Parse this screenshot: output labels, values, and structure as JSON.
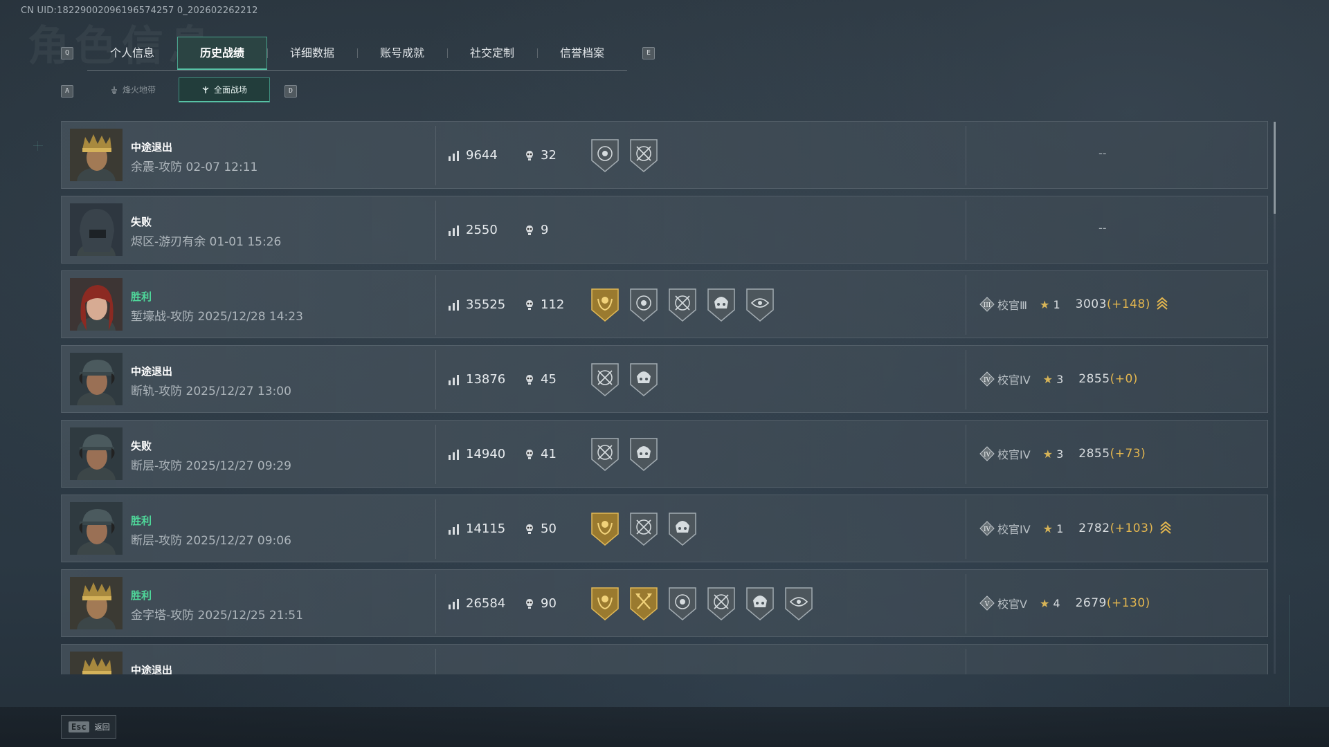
{
  "uid": "CN UID:18229002096196574257 0_202602262212",
  "ghost_title": "角色信息",
  "keys": {
    "prev_tab": "Q",
    "next_tab": "E",
    "prev_sub": "A",
    "next_sub": "D"
  },
  "tabs": [
    {
      "label": "个人信息",
      "active": false
    },
    {
      "label": "历史战绩",
      "active": true
    },
    {
      "label": "详细数据",
      "active": false
    },
    {
      "label": "账号成就",
      "active": false
    },
    {
      "label": "社交定制",
      "active": false
    },
    {
      "label": "信誉档案",
      "active": false
    }
  ],
  "subtabs": [
    {
      "label": "烽火地带",
      "active": false
    },
    {
      "label": "全面战场",
      "active": true
    }
  ],
  "colors": {
    "accent": "#57c2a5",
    "win": "#4fd99b",
    "gold": "#e3b64f"
  },
  "matches": [
    {
      "avatar": "avatar-crown-warrior",
      "result": "中途退出",
      "win": false,
      "map": "余震-攻防 02-07 12:11",
      "score": "9644",
      "kills": "32",
      "medals": [
        "silver-skull-target",
        "silver-crossed-scope"
      ],
      "rank": null,
      "no_rank_text": "--"
    },
    {
      "avatar": "avatar-hooded-soldier",
      "result": "失败",
      "win": false,
      "map": "烬区-游刃有余 01-01 15:26",
      "score": "2550",
      "kills": "9",
      "medals": [],
      "rank": null,
      "no_rank_text": "--"
    },
    {
      "avatar": "avatar-red-hair-woman",
      "result": "胜利",
      "win": true,
      "map": "堑壕战-攻防 2025/12/28 14:23",
      "score": "35525",
      "kills": "112",
      "medals": [
        "gold-laurel",
        "silver-skull-target",
        "silver-crossed-scope",
        "silver-helmet-skull",
        "silver-eye"
      ],
      "rank": {
        "tier": "III",
        "name": "校官Ⅲ",
        "stars": "1",
        "rating": "3003",
        "delta": "(+148)",
        "promo": true
      }
    },
    {
      "avatar": "avatar-cap-soldier",
      "result": "中途退出",
      "win": false,
      "map": "断轨-攻防 2025/12/27 13:00",
      "score": "13876",
      "kills": "45",
      "medals": [
        "silver-crossed-scope",
        "silver-helmet-skull"
      ],
      "rank": {
        "tier": "IV",
        "name": "校官IV",
        "stars": "3",
        "rating": "2855",
        "delta": "(+0)",
        "promo": false
      }
    },
    {
      "avatar": "avatar-cap-soldier",
      "result": "失败",
      "win": false,
      "map": "断层-攻防 2025/12/27 09:29",
      "score": "14940",
      "kills": "41",
      "medals": [
        "silver-crossed-scope",
        "silver-helmet-skull"
      ],
      "rank": {
        "tier": "IV",
        "name": "校官IV",
        "stars": "3",
        "rating": "2855",
        "delta": "(+73)",
        "promo": false
      }
    },
    {
      "avatar": "avatar-cap-soldier",
      "result": "胜利",
      "win": true,
      "map": "断层-攻防 2025/12/27 09:06",
      "score": "14115",
      "kills": "50",
      "medals": [
        "gold-laurel",
        "silver-crossed-scope",
        "silver-helmet-skull"
      ],
      "rank": {
        "tier": "IV",
        "name": "校官IV",
        "stars": "1",
        "rating": "2782",
        "delta": "(+103)",
        "promo": true
      }
    },
    {
      "avatar": "avatar-crown-warrior",
      "result": "胜利",
      "win": true,
      "map": "金字塔-攻防 2025/12/25 21:51",
      "score": "26584",
      "kills": "90",
      "medals": [
        "gold-laurel",
        "gold-crossed-axes",
        "silver-skull-target",
        "silver-crossed-scope",
        "silver-helmet-skull",
        "silver-eye"
      ],
      "rank": {
        "tier": "V",
        "name": "校官V",
        "stars": "4",
        "rating": "2679",
        "delta": "(+130)",
        "promo": false
      }
    },
    {
      "avatar": "avatar-crown-warrior",
      "result": "中途退出",
      "win": false,
      "map": "",
      "score": "",
      "kills": "",
      "medals": [],
      "rank": null,
      "no_rank_text": ""
    }
  ],
  "footer": {
    "esc_key": "Esc",
    "back_label": "返回"
  }
}
